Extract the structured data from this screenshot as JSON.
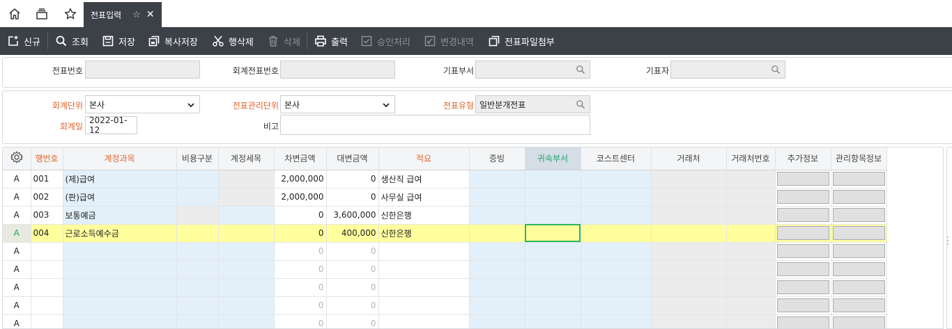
{
  "tab": {
    "title": "전표입력"
  },
  "toolbar": {
    "new": "신규",
    "search": "조회",
    "save": "저장",
    "copy_save": "복사저장",
    "delete_row": "행삭제",
    "delete": "삭제",
    "print": "출력",
    "approve": "승인처리",
    "history": "변경내역",
    "attach": "전표파일첨부"
  },
  "search": {
    "slip_no_label": "전표번호",
    "slip_no": "",
    "acc_slip_no_label": "회계전표번호",
    "acc_slip_no": "",
    "dept_label": "기표부서",
    "dept": "",
    "writer_label": "기표자",
    "writer": ""
  },
  "form": {
    "acc_unit_label": "회계단위",
    "acc_unit": "본사",
    "mgmt_unit_label": "전표관리단위",
    "mgmt_unit": "본사",
    "slip_type_label": "전표유형",
    "slip_type": "일반분개전표",
    "acc_date_label": "회계일",
    "acc_date": "2022-01-12",
    "remark_label": "비고",
    "remark": ""
  },
  "grid": {
    "headers": {
      "row_no": "행번호",
      "account": "계정과목",
      "cost_type": "비용구분",
      "account_detail": "계정세목",
      "debit": "차변금액",
      "credit": "대변금액",
      "summary": "적요",
      "evidence": "증빙",
      "dept": "귀속부서",
      "cost_center": "코스트센터",
      "partner": "거래처",
      "partner_no": "거래처번호",
      "extra": "추가정보",
      "mgmt": "관리항목정보"
    },
    "rows": [
      {
        "mark": "A",
        "no": "001",
        "account": "(제)급여",
        "debit": "2,000,000",
        "credit": "0",
        "summary": "생산직 급여"
      },
      {
        "mark": "A",
        "no": "002",
        "account": "(판)급여",
        "debit": "2,000,000",
        "credit": "0",
        "summary": "사무실 급여"
      },
      {
        "mark": "A",
        "no": "003",
        "account": "보통예금",
        "debit": "0",
        "credit": "3,600,000",
        "summary": "신한은행"
      },
      {
        "mark": "A",
        "no": "004",
        "account": "근로소득예수금",
        "debit": "0",
        "credit": "400,000",
        "summary": "신한은행"
      },
      {
        "mark": "A",
        "no": "",
        "account": "",
        "debit": "0",
        "credit": "0",
        "summary": ""
      },
      {
        "mark": "A",
        "no": "",
        "account": "",
        "debit": "0",
        "credit": "0",
        "summary": ""
      },
      {
        "mark": "A",
        "no": "",
        "account": "",
        "debit": "0",
        "credit": "0",
        "summary": ""
      },
      {
        "mark": "A",
        "no": "",
        "account": "",
        "debit": "0",
        "credit": "0",
        "summary": ""
      },
      {
        "mark": "A",
        "no": "",
        "account": "",
        "debit": "0",
        "credit": "0",
        "summary": ""
      }
    ]
  },
  "colors": {
    "toolbar_bg": "#3c4148",
    "required_label": "#e0652d",
    "active_header": "#19a567",
    "selected_row": "#ffff9e",
    "editable_cell": "#e3f0f9"
  }
}
